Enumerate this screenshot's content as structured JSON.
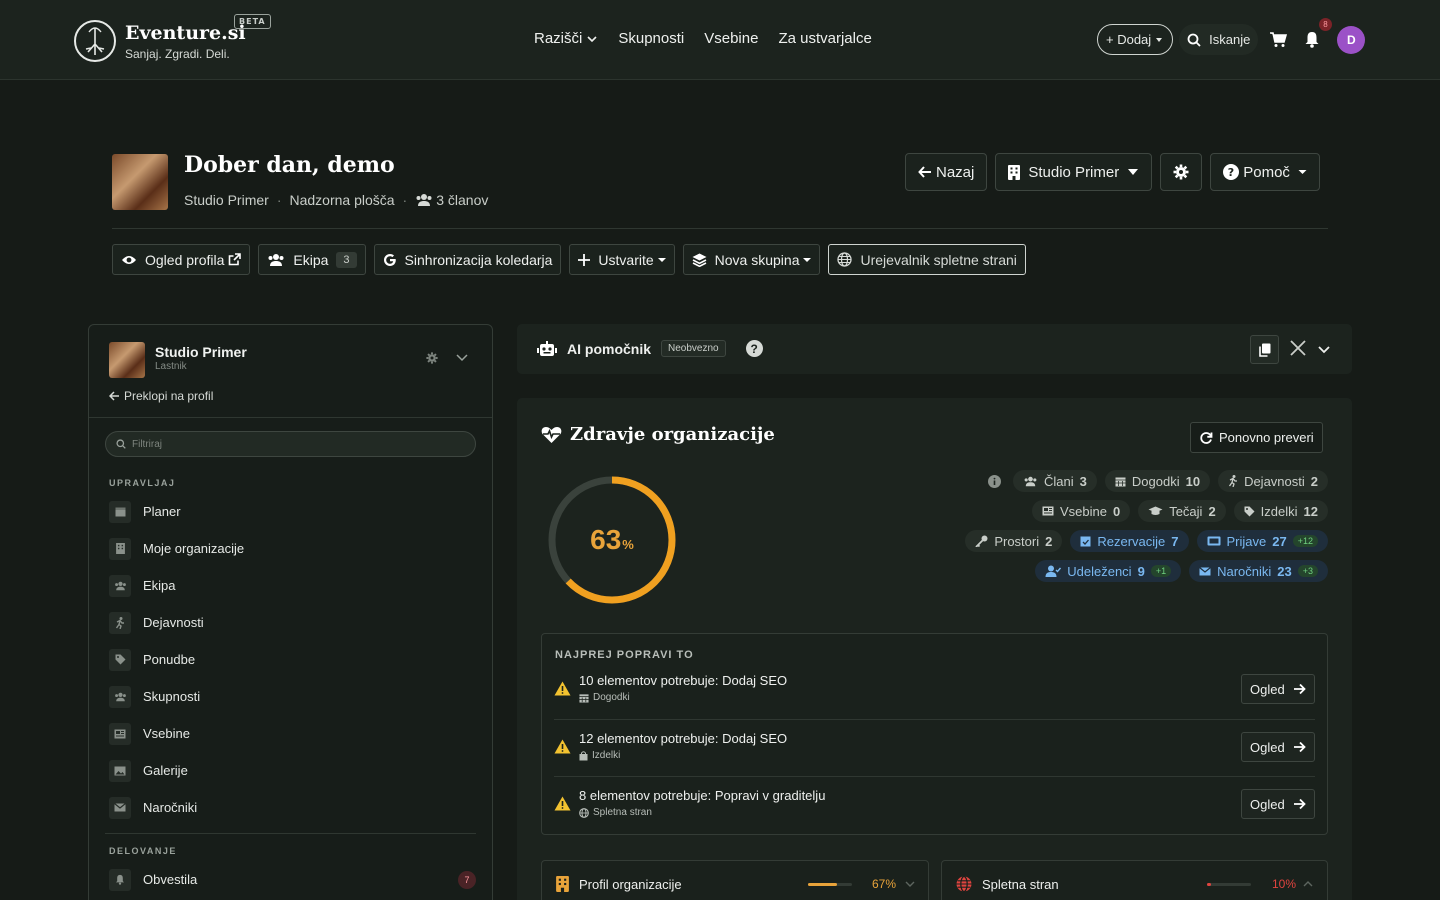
{
  "brand": {
    "name": "Eventure.si",
    "tagline": "Sanjaj. Zgradi. Deli.",
    "beta": "BETA"
  },
  "nav": {
    "items": [
      "Razišči",
      "Skupnosti",
      "Vsebine",
      "Za ustvarjalce"
    ],
    "add_label": "+ Dodaj",
    "search_label": "Iskanje",
    "notif_count": "8",
    "avatar_initial": "D"
  },
  "header": {
    "greeting": "Dober dan, demo",
    "org": "Studio Primer",
    "page": "Nadzorna plošča",
    "members": "3 članov",
    "back": "Nazaj",
    "org_switch": "Studio Primer",
    "help": "Pomoč"
  },
  "actions": {
    "profile": "Ogled profila",
    "team": "Ekipa",
    "team_count": "3",
    "sync": "Sinhronizacija koledarja",
    "create": "Ustvarite",
    "group": "Nova skupina",
    "editor": "Urejevalnik spletne strani"
  },
  "sidebar": {
    "org_name": "Studio Primer",
    "role": "Lastnik",
    "switch": "Preklopi na profil",
    "filter_placeholder": "Filtriraj",
    "section_manage": "UPRAVLJAJ",
    "items": [
      "Planer",
      "Moje organizacije",
      "Ekipa",
      "Dejavnosti",
      "Ponudbe",
      "Skupnosti",
      "Vsebine",
      "Galerije",
      "Naročniki"
    ],
    "section_ops": "DELOVANJE",
    "ops_items": [
      {
        "label": "Obvestila",
        "count": "7"
      }
    ]
  },
  "ai": {
    "title": "AI pomočnik",
    "badge": "Neobvezno",
    "help": "?"
  },
  "health": {
    "title": "Zdravje organizacije",
    "recheck": "Ponovno preveri",
    "score": 63,
    "score_text": "63",
    "score_unit": "%",
    "chips": [
      {
        "label": "Člani",
        "value": "3"
      },
      {
        "label": "Dogodki",
        "value": "10"
      },
      {
        "label": "Dejavnosti",
        "value": "2"
      },
      {
        "label": "Vsebine",
        "value": "0"
      },
      {
        "label": "Tečaji",
        "value": "2"
      },
      {
        "label": "Izdelki",
        "value": "12"
      },
      {
        "label": "Prostori",
        "value": "2"
      },
      {
        "label": "Rezervacije",
        "value": "7"
      },
      {
        "label": "Prijave",
        "value": "27",
        "plus": "+12"
      },
      {
        "label": "Udeleženci",
        "value": "9",
        "plus": "+1"
      },
      {
        "label": "Naročniki",
        "value": "23",
        "plus": "+3"
      }
    ],
    "fix_title": "NAJPREJ POPRAVI TO",
    "fixes": [
      {
        "text": "10 elementov potrebuje: Dodaj SEO",
        "area": "Dogodki",
        "action": "Ogled"
      },
      {
        "text": "12 elementov potrebuje: Dodaj SEO",
        "area": "Izdelki",
        "action": "Ogled"
      },
      {
        "text": "8 elementov potrebuje: Popravi v graditelju",
        "area": "Spletna stran",
        "action": "Ogled"
      }
    ],
    "sections": [
      {
        "label": "Profil organizacije",
        "pct_text": "67%",
        "pct": 0.67,
        "color": "#e8a33a"
      },
      {
        "label": "Spletna stran",
        "pct_text": "10%",
        "pct": 0.1,
        "color": "#e0443f"
      }
    ]
  }
}
